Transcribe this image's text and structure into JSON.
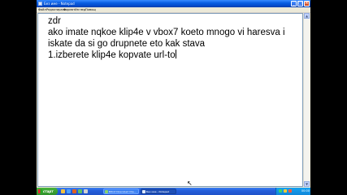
{
  "window": {
    "title": "Без име - Notepad",
    "minimize_glyph": "_",
    "maximize_glyph": "□",
    "close_glyph": "×"
  },
  "menu": {
    "items": [
      {
        "label": "Файл"
      },
      {
        "label": "Редактиране"
      },
      {
        "label": "Формат"
      },
      {
        "label": "Изглед"
      },
      {
        "label": "Помощ"
      }
    ]
  },
  "editor": {
    "text": "zdr\nako imate nqkoe klip4e v vbox7 koeto mnogo vi haresva i iskate da si go drupnete eto kak stava\n1.izberete klip4e kopvate url-to"
  },
  "scrollbar": {
    "up_glyph": "▲",
    "down_glyph": "▼"
  },
  "cursor": {
    "glyph": "↖"
  },
  "taskbar": {
    "start_label": "старт",
    "tasks": [
      {
        "label": "Bitrot Download Clie..."
      },
      {
        "label": "Без име - Notepad"
      }
    ],
    "clock": "00:00"
  },
  "colors": {
    "titlebar": "#0a5fe3",
    "taskbar": "#245edb",
    "start_button": "#2f8f2a",
    "tray": "#0f86d9"
  }
}
